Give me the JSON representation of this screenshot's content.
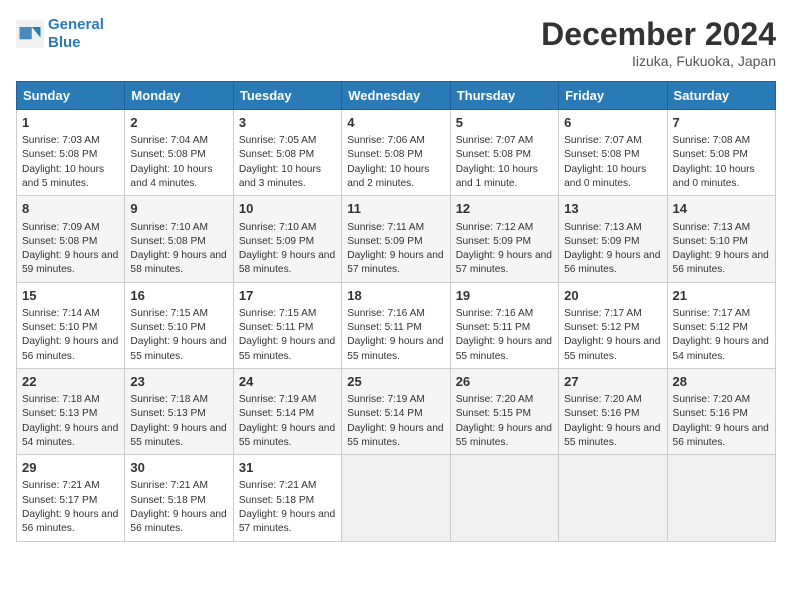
{
  "header": {
    "logo_line1": "General",
    "logo_line2": "Blue",
    "month": "December 2024",
    "location": "Iizuka, Fukuoka, Japan"
  },
  "weekdays": [
    "Sunday",
    "Monday",
    "Tuesday",
    "Wednesday",
    "Thursday",
    "Friday",
    "Saturday"
  ],
  "weeks": [
    [
      {
        "day": "1",
        "sunrise": "Sunrise: 7:03 AM",
        "sunset": "Sunset: 5:08 PM",
        "daylight": "Daylight: 10 hours and 5 minutes."
      },
      {
        "day": "2",
        "sunrise": "Sunrise: 7:04 AM",
        "sunset": "Sunset: 5:08 PM",
        "daylight": "Daylight: 10 hours and 4 minutes."
      },
      {
        "day": "3",
        "sunrise": "Sunrise: 7:05 AM",
        "sunset": "Sunset: 5:08 PM",
        "daylight": "Daylight: 10 hours and 3 minutes."
      },
      {
        "day": "4",
        "sunrise": "Sunrise: 7:06 AM",
        "sunset": "Sunset: 5:08 PM",
        "daylight": "Daylight: 10 hours and 2 minutes."
      },
      {
        "day": "5",
        "sunrise": "Sunrise: 7:07 AM",
        "sunset": "Sunset: 5:08 PM",
        "daylight": "Daylight: 10 hours and 1 minute."
      },
      {
        "day": "6",
        "sunrise": "Sunrise: 7:07 AM",
        "sunset": "Sunset: 5:08 PM",
        "daylight": "Daylight: 10 hours and 0 minutes."
      },
      {
        "day": "7",
        "sunrise": "Sunrise: 7:08 AM",
        "sunset": "Sunset: 5:08 PM",
        "daylight": "Daylight: 10 hours and 0 minutes."
      }
    ],
    [
      {
        "day": "8",
        "sunrise": "Sunrise: 7:09 AM",
        "sunset": "Sunset: 5:08 PM",
        "daylight": "Daylight: 9 hours and 59 minutes."
      },
      {
        "day": "9",
        "sunrise": "Sunrise: 7:10 AM",
        "sunset": "Sunset: 5:08 PM",
        "daylight": "Daylight: 9 hours and 58 minutes."
      },
      {
        "day": "10",
        "sunrise": "Sunrise: 7:10 AM",
        "sunset": "Sunset: 5:09 PM",
        "daylight": "Daylight: 9 hours and 58 minutes."
      },
      {
        "day": "11",
        "sunrise": "Sunrise: 7:11 AM",
        "sunset": "Sunset: 5:09 PM",
        "daylight": "Daylight: 9 hours and 57 minutes."
      },
      {
        "day": "12",
        "sunrise": "Sunrise: 7:12 AM",
        "sunset": "Sunset: 5:09 PM",
        "daylight": "Daylight: 9 hours and 57 minutes."
      },
      {
        "day": "13",
        "sunrise": "Sunrise: 7:13 AM",
        "sunset": "Sunset: 5:09 PM",
        "daylight": "Daylight: 9 hours and 56 minutes."
      },
      {
        "day": "14",
        "sunrise": "Sunrise: 7:13 AM",
        "sunset": "Sunset: 5:10 PM",
        "daylight": "Daylight: 9 hours and 56 minutes."
      }
    ],
    [
      {
        "day": "15",
        "sunrise": "Sunrise: 7:14 AM",
        "sunset": "Sunset: 5:10 PM",
        "daylight": "Daylight: 9 hours and 56 minutes."
      },
      {
        "day": "16",
        "sunrise": "Sunrise: 7:15 AM",
        "sunset": "Sunset: 5:10 PM",
        "daylight": "Daylight: 9 hours and 55 minutes."
      },
      {
        "day": "17",
        "sunrise": "Sunrise: 7:15 AM",
        "sunset": "Sunset: 5:11 PM",
        "daylight": "Daylight: 9 hours and 55 minutes."
      },
      {
        "day": "18",
        "sunrise": "Sunrise: 7:16 AM",
        "sunset": "Sunset: 5:11 PM",
        "daylight": "Daylight: 9 hours and 55 minutes."
      },
      {
        "day": "19",
        "sunrise": "Sunrise: 7:16 AM",
        "sunset": "Sunset: 5:11 PM",
        "daylight": "Daylight: 9 hours and 55 minutes."
      },
      {
        "day": "20",
        "sunrise": "Sunrise: 7:17 AM",
        "sunset": "Sunset: 5:12 PM",
        "daylight": "Daylight: 9 hours and 55 minutes."
      },
      {
        "day": "21",
        "sunrise": "Sunrise: 7:17 AM",
        "sunset": "Sunset: 5:12 PM",
        "daylight": "Daylight: 9 hours and 54 minutes."
      }
    ],
    [
      {
        "day": "22",
        "sunrise": "Sunrise: 7:18 AM",
        "sunset": "Sunset: 5:13 PM",
        "daylight": "Daylight: 9 hours and 54 minutes."
      },
      {
        "day": "23",
        "sunrise": "Sunrise: 7:18 AM",
        "sunset": "Sunset: 5:13 PM",
        "daylight": "Daylight: 9 hours and 55 minutes."
      },
      {
        "day": "24",
        "sunrise": "Sunrise: 7:19 AM",
        "sunset": "Sunset: 5:14 PM",
        "daylight": "Daylight: 9 hours and 55 minutes."
      },
      {
        "day": "25",
        "sunrise": "Sunrise: 7:19 AM",
        "sunset": "Sunset: 5:14 PM",
        "daylight": "Daylight: 9 hours and 55 minutes."
      },
      {
        "day": "26",
        "sunrise": "Sunrise: 7:20 AM",
        "sunset": "Sunset: 5:15 PM",
        "daylight": "Daylight: 9 hours and 55 minutes."
      },
      {
        "day": "27",
        "sunrise": "Sunrise: 7:20 AM",
        "sunset": "Sunset: 5:16 PM",
        "daylight": "Daylight: 9 hours and 55 minutes."
      },
      {
        "day": "28",
        "sunrise": "Sunrise: 7:20 AM",
        "sunset": "Sunset: 5:16 PM",
        "daylight": "Daylight: 9 hours and 56 minutes."
      }
    ],
    [
      {
        "day": "29",
        "sunrise": "Sunrise: 7:21 AM",
        "sunset": "Sunset: 5:17 PM",
        "daylight": "Daylight: 9 hours and 56 minutes."
      },
      {
        "day": "30",
        "sunrise": "Sunrise: 7:21 AM",
        "sunset": "Sunset: 5:18 PM",
        "daylight": "Daylight: 9 hours and 56 minutes."
      },
      {
        "day": "31",
        "sunrise": "Sunrise: 7:21 AM",
        "sunset": "Sunset: 5:18 PM",
        "daylight": "Daylight: 9 hours and 57 minutes."
      },
      null,
      null,
      null,
      null
    ]
  ]
}
